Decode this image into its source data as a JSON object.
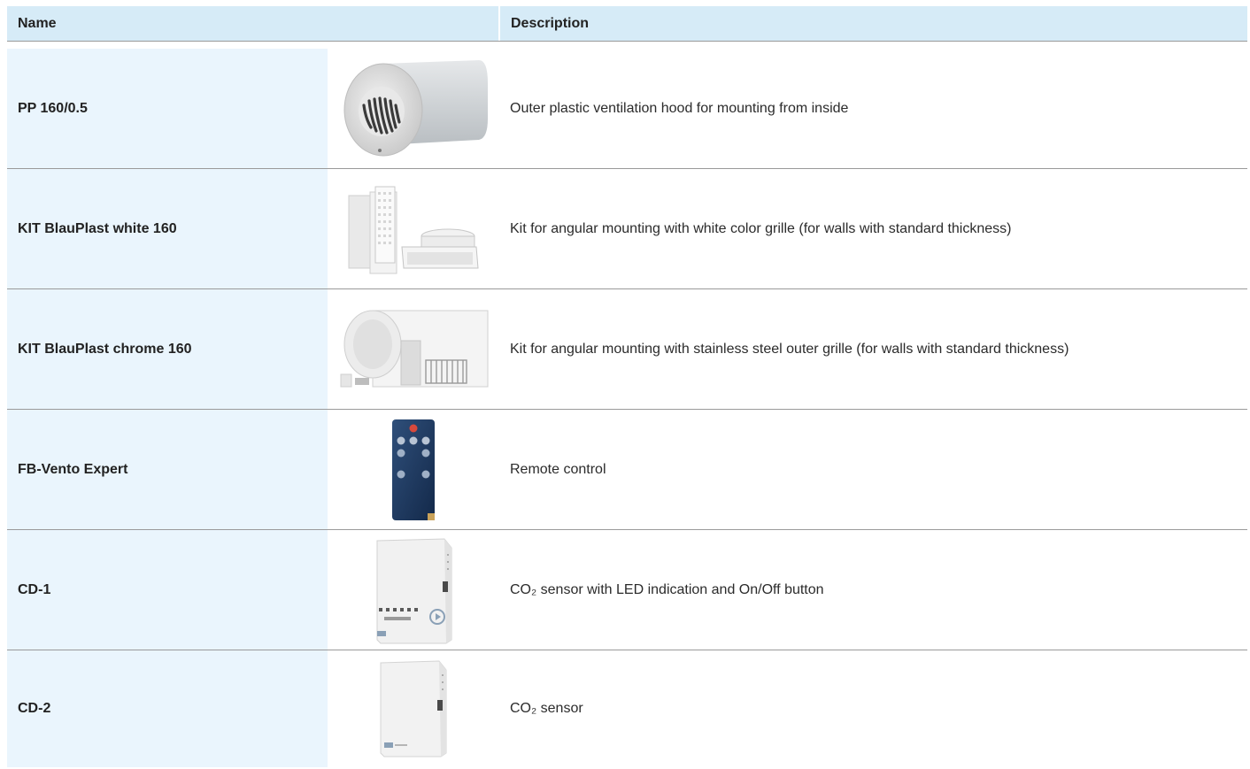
{
  "table": {
    "headers": {
      "name": "Name",
      "description": "Description"
    },
    "rows": [
      {
        "name": "PP 160/0.5",
        "description": "Outer plastic ventilation hood for mounting from inside",
        "image": "ventilation-hood-image"
      },
      {
        "name": "KIT BlauPlast white 160",
        "description": "Kit for angular mounting with white color grille (for walls with standard thickness)",
        "image": "white-kit-image"
      },
      {
        "name": "KIT BlauPlast chrome 160",
        "description": "Kit for angular mounting with stainless steel outer grille (for walls with standard thickness)",
        "image": "chrome-kit-image"
      },
      {
        "name": "FB-Vento Expert",
        "description": "Remote control",
        "image": "remote-control-image"
      },
      {
        "name": "CD-1",
        "description": "CO₂ sensor with LED indication and On/Off button",
        "image": "co2-sensor-led-image"
      },
      {
        "name": "CD-2",
        "description": "CO₂ sensor",
        "image": "co2-sensor-image"
      }
    ]
  }
}
